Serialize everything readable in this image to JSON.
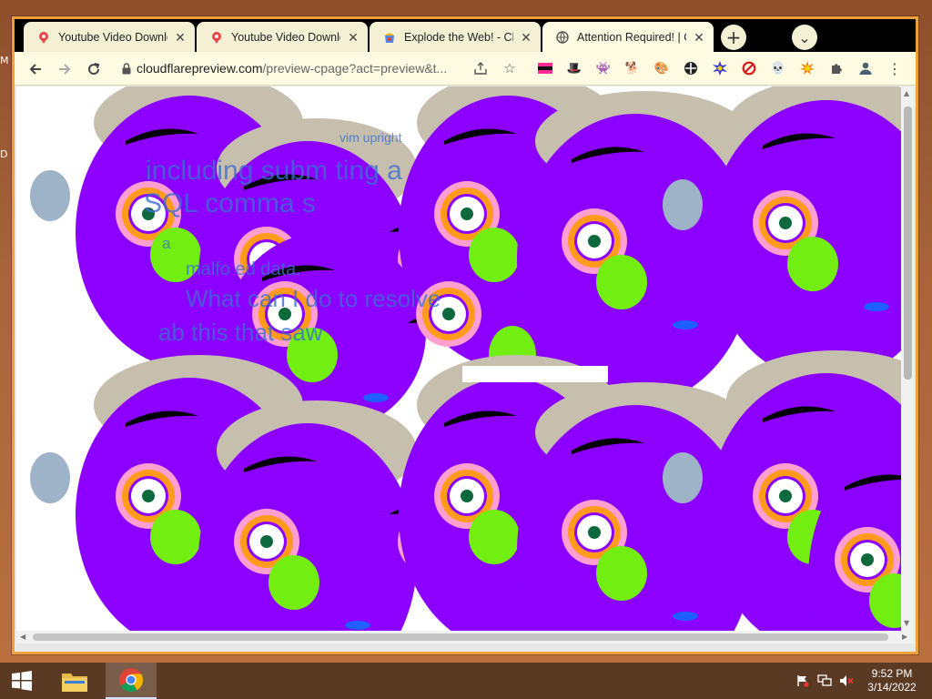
{
  "window_title": "Attention Required! | Cloudflare",
  "tabs": [
    {
      "title": "Youtube Video Downloa",
      "icon": "map-pin-icon",
      "active": false
    },
    {
      "title": "Youtube Video Downloa",
      "icon": "map-pin-icon",
      "active": false
    },
    {
      "title": "Explode the Web! - Chr",
      "icon": "chrome-store-icon",
      "active": false
    },
    {
      "title": "Attention Required! | Cl",
      "icon": "globe-icon",
      "active": true
    }
  ],
  "new_tab_symbol": "+",
  "tab_search_symbol": "⌄",
  "close_symbol": "✕",
  "url": {
    "host": "cloudflarepreview.com",
    "path": "/preview-cpage?act=preview&t..."
  },
  "page_fragments": {
    "line1": "vim upright",
    "line2": "including subm  ting a",
    "line3": "SQL comma  s",
    "line4": "a",
    "line5": "malfo  ed data.",
    "line6": "What can  I do to resolve",
    "line7": "ab  this  that  saw"
  },
  "page_colors": {
    "face": "#8b00ff",
    "cheek": "#72ee10",
    "eye_ring_orange": "#ff9a1a",
    "eye_ring_pink": "#ff9fcf",
    "iris": "#0e6a3c",
    "hat": "#c7bfae",
    "ear": "#9fb3c8",
    "mouth": "#1f5fff",
    "brow": "#000000"
  },
  "extensions": [
    "flag-icon",
    "hat-icon",
    "alien-icon",
    "dog-icon",
    "palette-icon",
    "crosshair-icon",
    "starburst-icon",
    "block-icon",
    "skull-icon",
    "sun-icon",
    "puzzle-icon",
    "profile-icon",
    "menu-icon"
  ],
  "taskbar": {
    "time": "9:52 PM",
    "date": "3/14/2022"
  }
}
